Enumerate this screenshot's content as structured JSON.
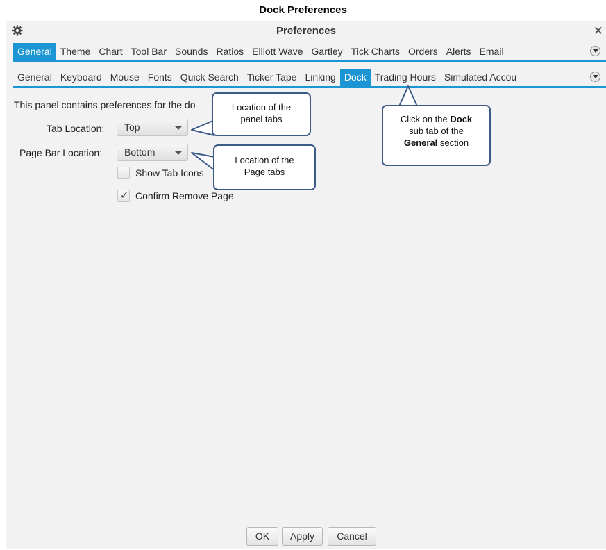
{
  "document": {
    "title": "Dock Preferences"
  },
  "window": {
    "title": "Preferences",
    "close_glyph": "✕"
  },
  "main_tabs": [
    {
      "label": "General",
      "active": true
    },
    {
      "label": "Theme"
    },
    {
      "label": "Chart"
    },
    {
      "label": "Tool Bar"
    },
    {
      "label": "Sounds"
    },
    {
      "label": "Ratios"
    },
    {
      "label": "Elliott Wave"
    },
    {
      "label": "Gartley"
    },
    {
      "label": "Tick Charts"
    },
    {
      "label": "Orders"
    },
    {
      "label": "Alerts"
    },
    {
      "label": "Email"
    }
  ],
  "sub_tabs": [
    {
      "label": "General"
    },
    {
      "label": "Keyboard"
    },
    {
      "label": "Mouse"
    },
    {
      "label": "Fonts"
    },
    {
      "label": "Quick Search"
    },
    {
      "label": "Ticker Tape"
    },
    {
      "label": "Linking"
    },
    {
      "label": "Dock",
      "active": true
    },
    {
      "label": "Trading Hours"
    },
    {
      "label": "Simulated Accou"
    }
  ],
  "panel": {
    "intro": "This panel contains preferences for the do",
    "tab_location": {
      "label": "Tab Location:",
      "value": "Top"
    },
    "page_bar_location": {
      "label": "Page Bar Location:",
      "value": "Bottom"
    },
    "show_tab_icons": {
      "label": "Show Tab Icons",
      "checked": false
    },
    "confirm_remove_page": {
      "label": "Confirm Remove Page",
      "checked": true
    }
  },
  "callouts": {
    "panel_tabs": {
      "line1": "Location of the",
      "line2": "panel tabs"
    },
    "page_tabs": {
      "line1": "Location of the",
      "line2": "Page tabs"
    },
    "dock_tab": {
      "line1_pre": "Click on the ",
      "line1_bold": "Dock",
      "line2": "sub tab of the",
      "line3_bold": "General",
      "line3_post": " section"
    }
  },
  "buttons": {
    "ok": "OK",
    "apply": "Apply",
    "cancel": "Cancel"
  },
  "colors": {
    "accent": "#1b95d3",
    "callout_border": "#3b5a87",
    "background": "#f2f2f2"
  },
  "icons": {
    "settings": "gear-icon",
    "close": "close-icon",
    "overflow": "chevron-down-icon",
    "check": "checkmark-icon"
  }
}
